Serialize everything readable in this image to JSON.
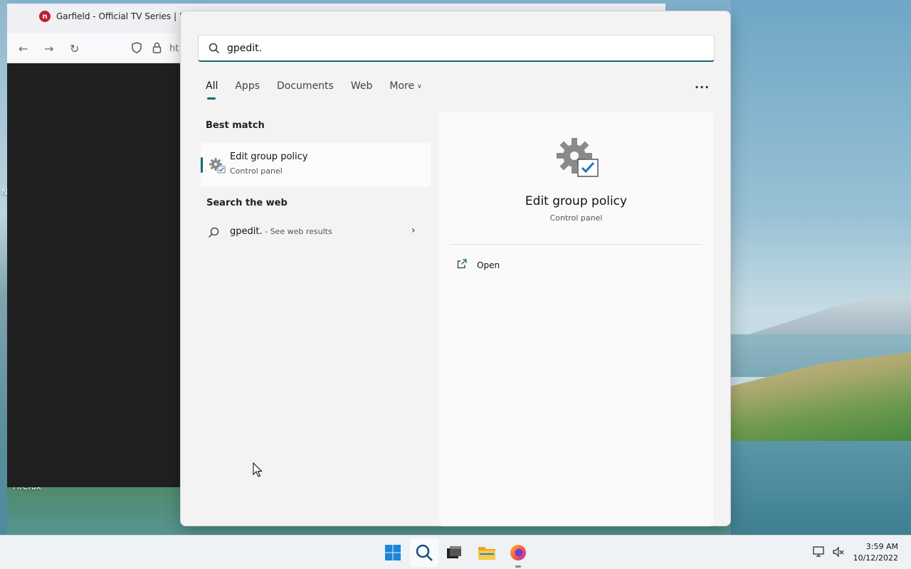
{
  "desktop": {
    "icon_label_firefox": "Firefox",
    "partial_label_n": "N"
  },
  "browser": {
    "tab_title": "Garfield - Official TV Series | Nic",
    "favicon_letter": "n",
    "url_partial": "ht"
  },
  "search": {
    "query": "gpedit.",
    "tabs": [
      {
        "label": "All"
      },
      {
        "label": "Apps"
      },
      {
        "label": "Documents"
      },
      {
        "label": "Web"
      },
      {
        "label": "More"
      }
    ],
    "more_options": "...",
    "best_match": {
      "section_title": "Best match",
      "title": "Edit group policy",
      "subtitle": "Control panel"
    },
    "web": {
      "section_title": "Search the web",
      "query": "gpedit.",
      "hint": " - See web results"
    },
    "preview": {
      "title": "Edit group policy",
      "subtitle": "Control panel",
      "action_open": "Open"
    }
  },
  "taskbar": {
    "time": "3:59 AM",
    "date": "10/12/2022"
  },
  "colors": {
    "accent": "#0f6b6e",
    "flyout_bg": "#f3f3f3",
    "check_blue": "#1a73c8"
  }
}
